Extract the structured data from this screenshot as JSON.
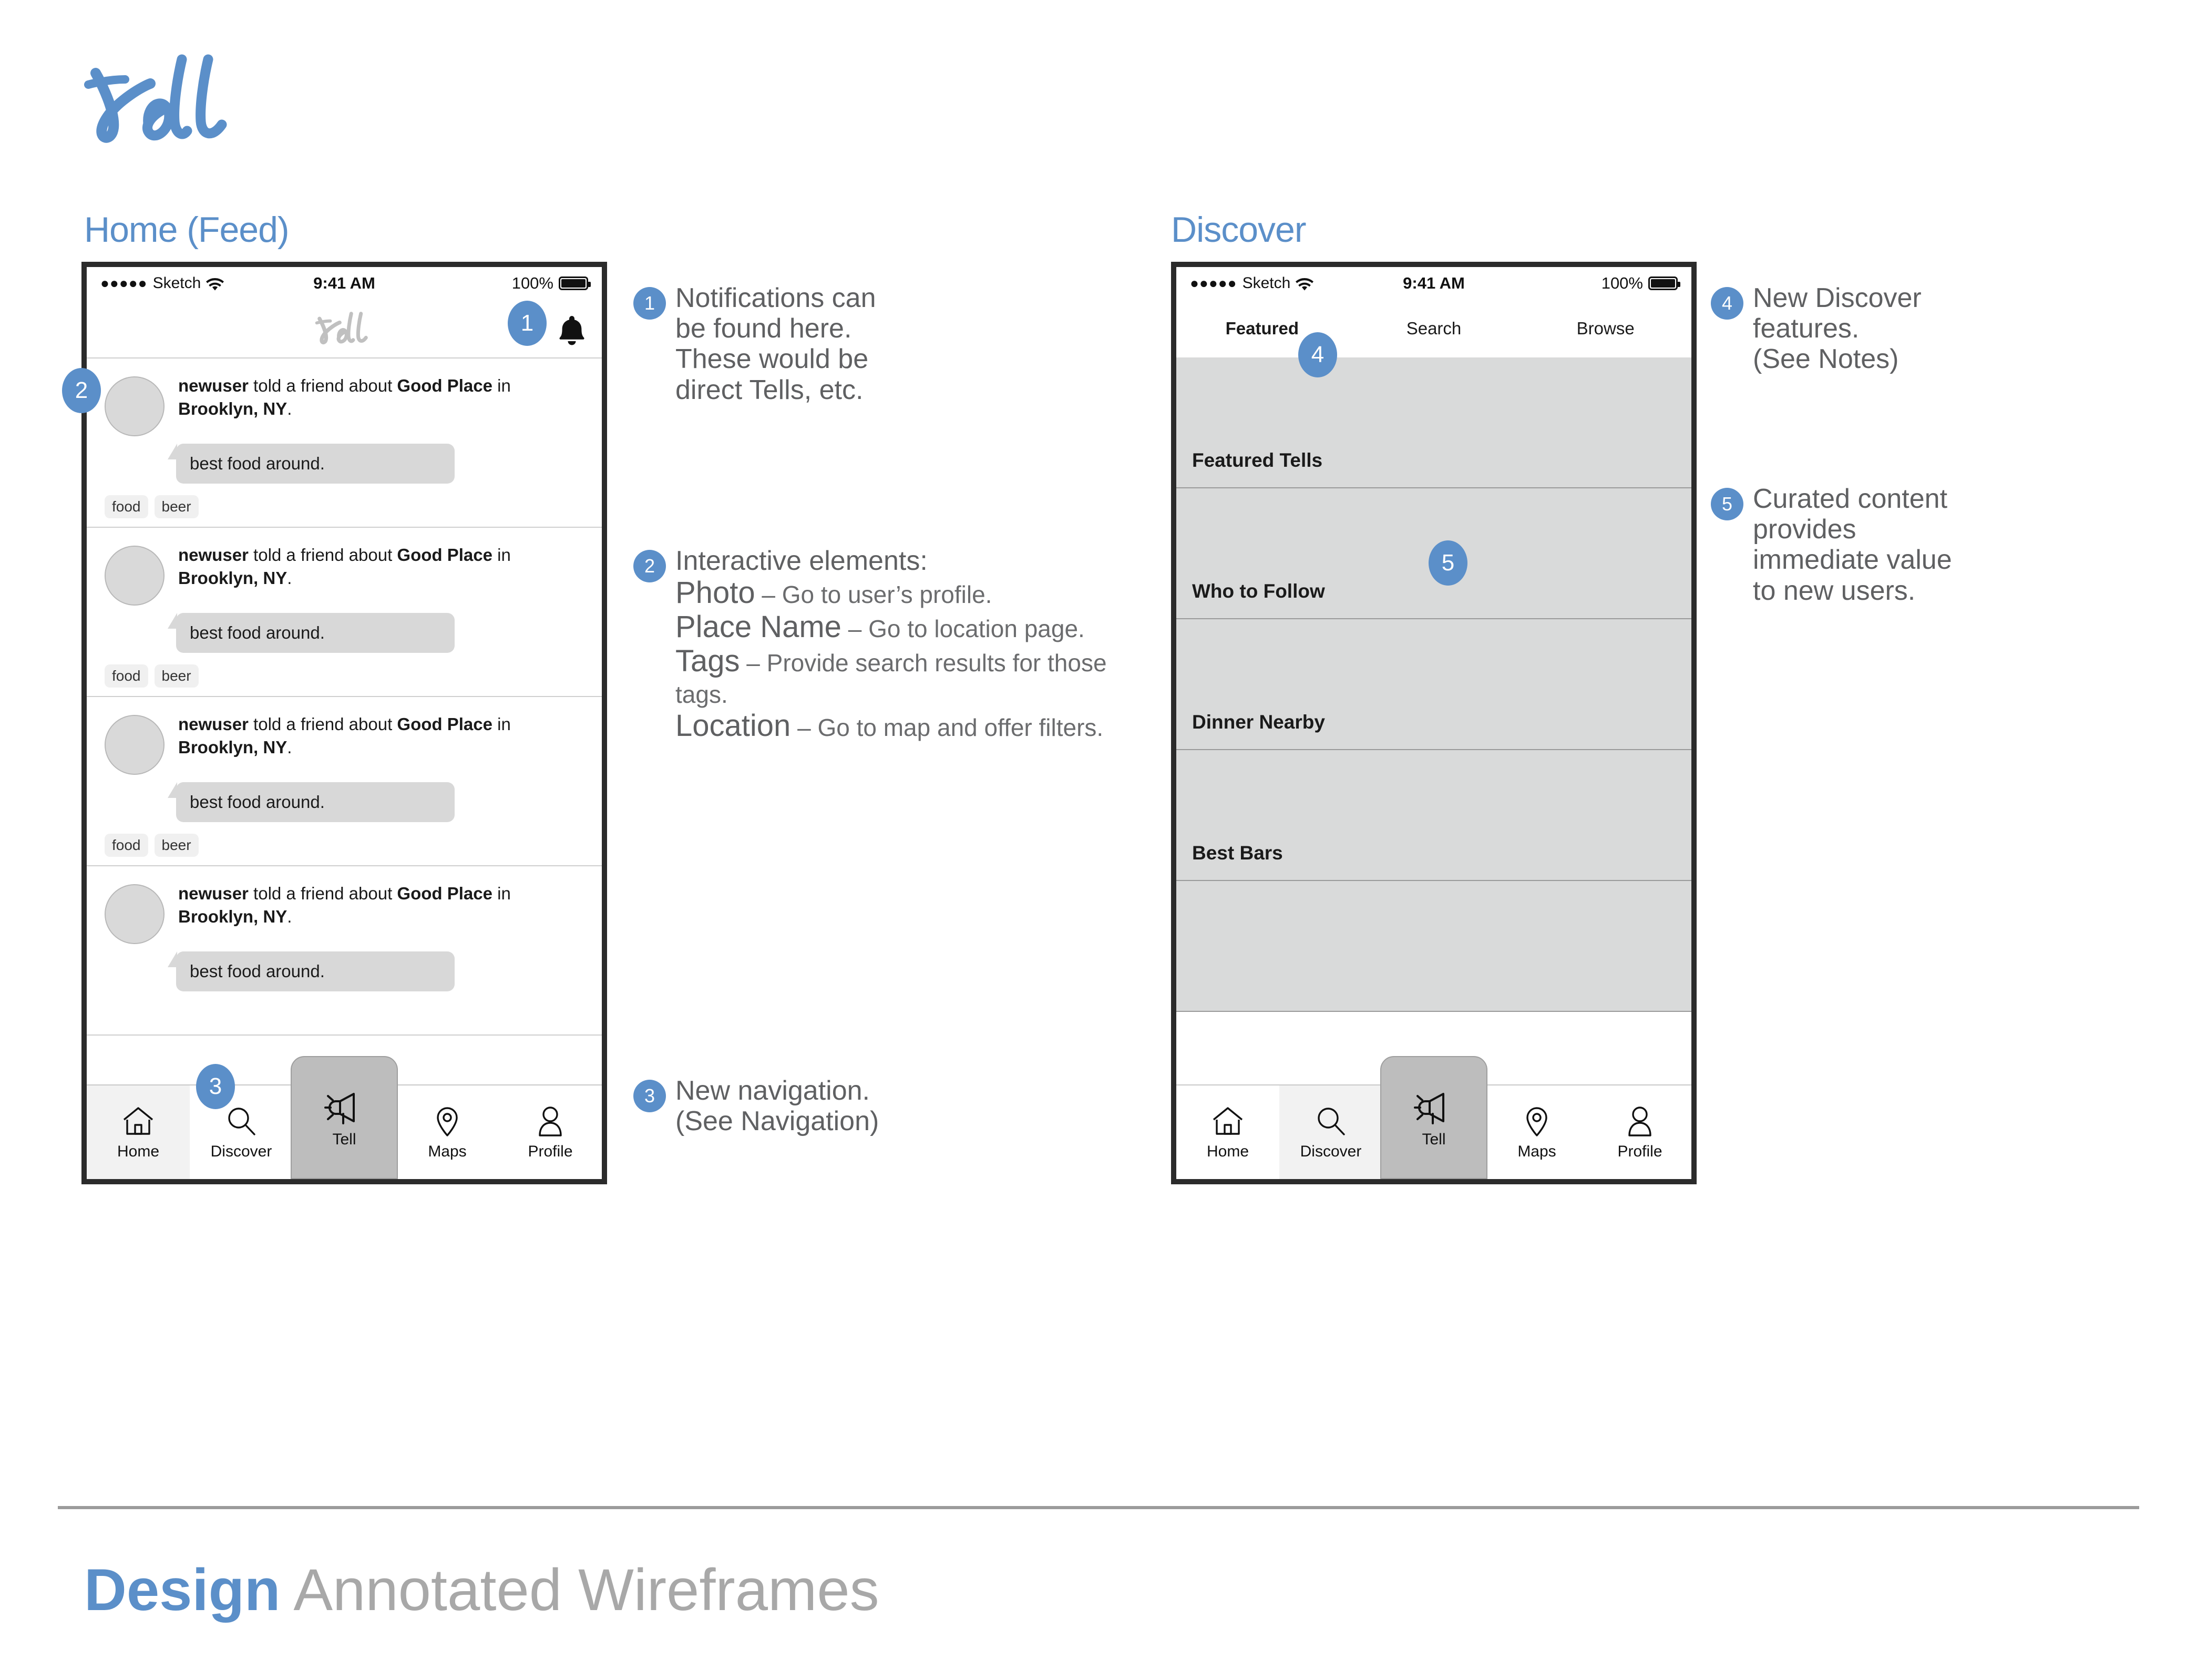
{
  "brand": {
    "logo_text": "tell"
  },
  "screens": [
    {
      "id": "home",
      "title": "Home (Feed)"
    },
    {
      "id": "discover",
      "title": "Discover"
    }
  ],
  "status_bar": {
    "signal_dots": "●●●●●",
    "carrier": "Sketch",
    "wifi_icon": "wifi-icon",
    "time": "9:41 AM",
    "battery_percent": "100%",
    "battery_icon": "battery-full-icon"
  },
  "home_screen": {
    "navbar": {
      "logo_text": "tell",
      "bell_icon": "bell-icon"
    },
    "feed_items": [
      {
        "avatar": "avatar-placeholder",
        "user": "newuser",
        "action": " told a friend about ",
        "place": "Good Place",
        "connector": "in ",
        "location": "Brooklyn, NY",
        "period": ".",
        "comment": "best food around.",
        "tags": [
          "food",
          "beer"
        ]
      },
      {
        "avatar": "avatar-placeholder",
        "user": "newuser",
        "action": " told a friend about ",
        "place": "Good Place",
        "connector": "in ",
        "location": "Brooklyn, NY",
        "period": ".",
        "comment": "best food around.",
        "tags": [
          "food",
          "beer"
        ]
      },
      {
        "avatar": "avatar-placeholder",
        "user": "newuser",
        "action": " told a friend about ",
        "place": "Good Place",
        "connector": "in ",
        "location": "Brooklyn, NY",
        "period": ".",
        "comment": "best food around.",
        "tags": [
          "food",
          "beer"
        ]
      },
      {
        "avatar": "avatar-placeholder",
        "user": "newuser",
        "action": " told a friend about ",
        "place": "Good Place",
        "connector": "in ",
        "location": "Brooklyn, NY",
        "period": ".",
        "comment": "best food around.",
        "tags": []
      }
    ],
    "tabbar": {
      "active": "Home",
      "items": [
        {
          "label": "Home",
          "icon": "home-icon"
        },
        {
          "label": "Discover",
          "icon": "search-icon"
        },
        {
          "label": "Tell",
          "icon": "megaphone-icon"
        },
        {
          "label": "Maps",
          "icon": "map-pin-icon"
        },
        {
          "label": "Profile",
          "icon": "person-icon"
        }
      ]
    }
  },
  "discover_screen": {
    "tabs": [
      {
        "label": "Featured",
        "selected": true
      },
      {
        "label": "Search",
        "selected": false
      },
      {
        "label": "Browse",
        "selected": false
      }
    ],
    "sections": [
      {
        "label": "Featured Tells"
      },
      {
        "label": "Who to Follow"
      },
      {
        "label": "Dinner Nearby"
      },
      {
        "label": "Best Bars"
      }
    ],
    "tabbar": {
      "active": "Discover",
      "items": [
        {
          "label": "Home",
          "icon": "home-icon"
        },
        {
          "label": "Discover",
          "icon": "search-icon"
        },
        {
          "label": "Tell",
          "icon": "megaphone-icon"
        },
        {
          "label": "Maps",
          "icon": "map-pin-icon"
        },
        {
          "label": "Profile",
          "icon": "person-icon"
        }
      ]
    }
  },
  "callouts": {
    "on_home": [
      {
        "number": "1",
        "target": "notifications-bell"
      },
      {
        "number": "2",
        "target": "avatar-photo"
      },
      {
        "number": "3",
        "target": "tab-bar-navigation"
      }
    ],
    "on_discover": [
      {
        "number": "4",
        "target": "discover-tabs"
      },
      {
        "number": "5",
        "target": "curated-sections"
      }
    ]
  },
  "annotations_left": [
    {
      "number": "1",
      "lines": [
        "Notifications can",
        "be found here.",
        "These would be",
        "direct Tells, etc."
      ]
    },
    {
      "number": "2",
      "heading": "Interactive elements:",
      "items": [
        {
          "term": "Photo",
          "dash": " – ",
          "desc": "Go to user’s profile."
        },
        {
          "term": "Place Name",
          "dash": " – ",
          "desc": "Go to location page."
        },
        {
          "term": "Tags",
          "dash": " – ",
          "desc": "Provide search results for those tags."
        },
        {
          "term": "Location",
          "dash": " – ",
          "desc": "Go to map and offer filters."
        }
      ]
    },
    {
      "number": "3",
      "lines": [
        "New navigation.",
        "(See Navigation)"
      ]
    }
  ],
  "annotations_right": [
    {
      "number": "4",
      "lines": [
        "New Discover",
        "features.",
        "(See Notes)"
      ]
    },
    {
      "number": "5",
      "lines": [
        "Curated content",
        "provides",
        "immediate value",
        "to new users."
      ]
    }
  ],
  "footer": {
    "title_highlight": "Design",
    "title_rest": " Annotated Wireframes"
  },
  "colors": {
    "accent_blue": "#5b8fc9",
    "text_gray": "#5f6062",
    "panel_gray": "#d9dada",
    "bubble_gray": "#d8d8d8",
    "frame_dark": "#2b2b2b",
    "footer_gray": "#a8a8a8"
  }
}
